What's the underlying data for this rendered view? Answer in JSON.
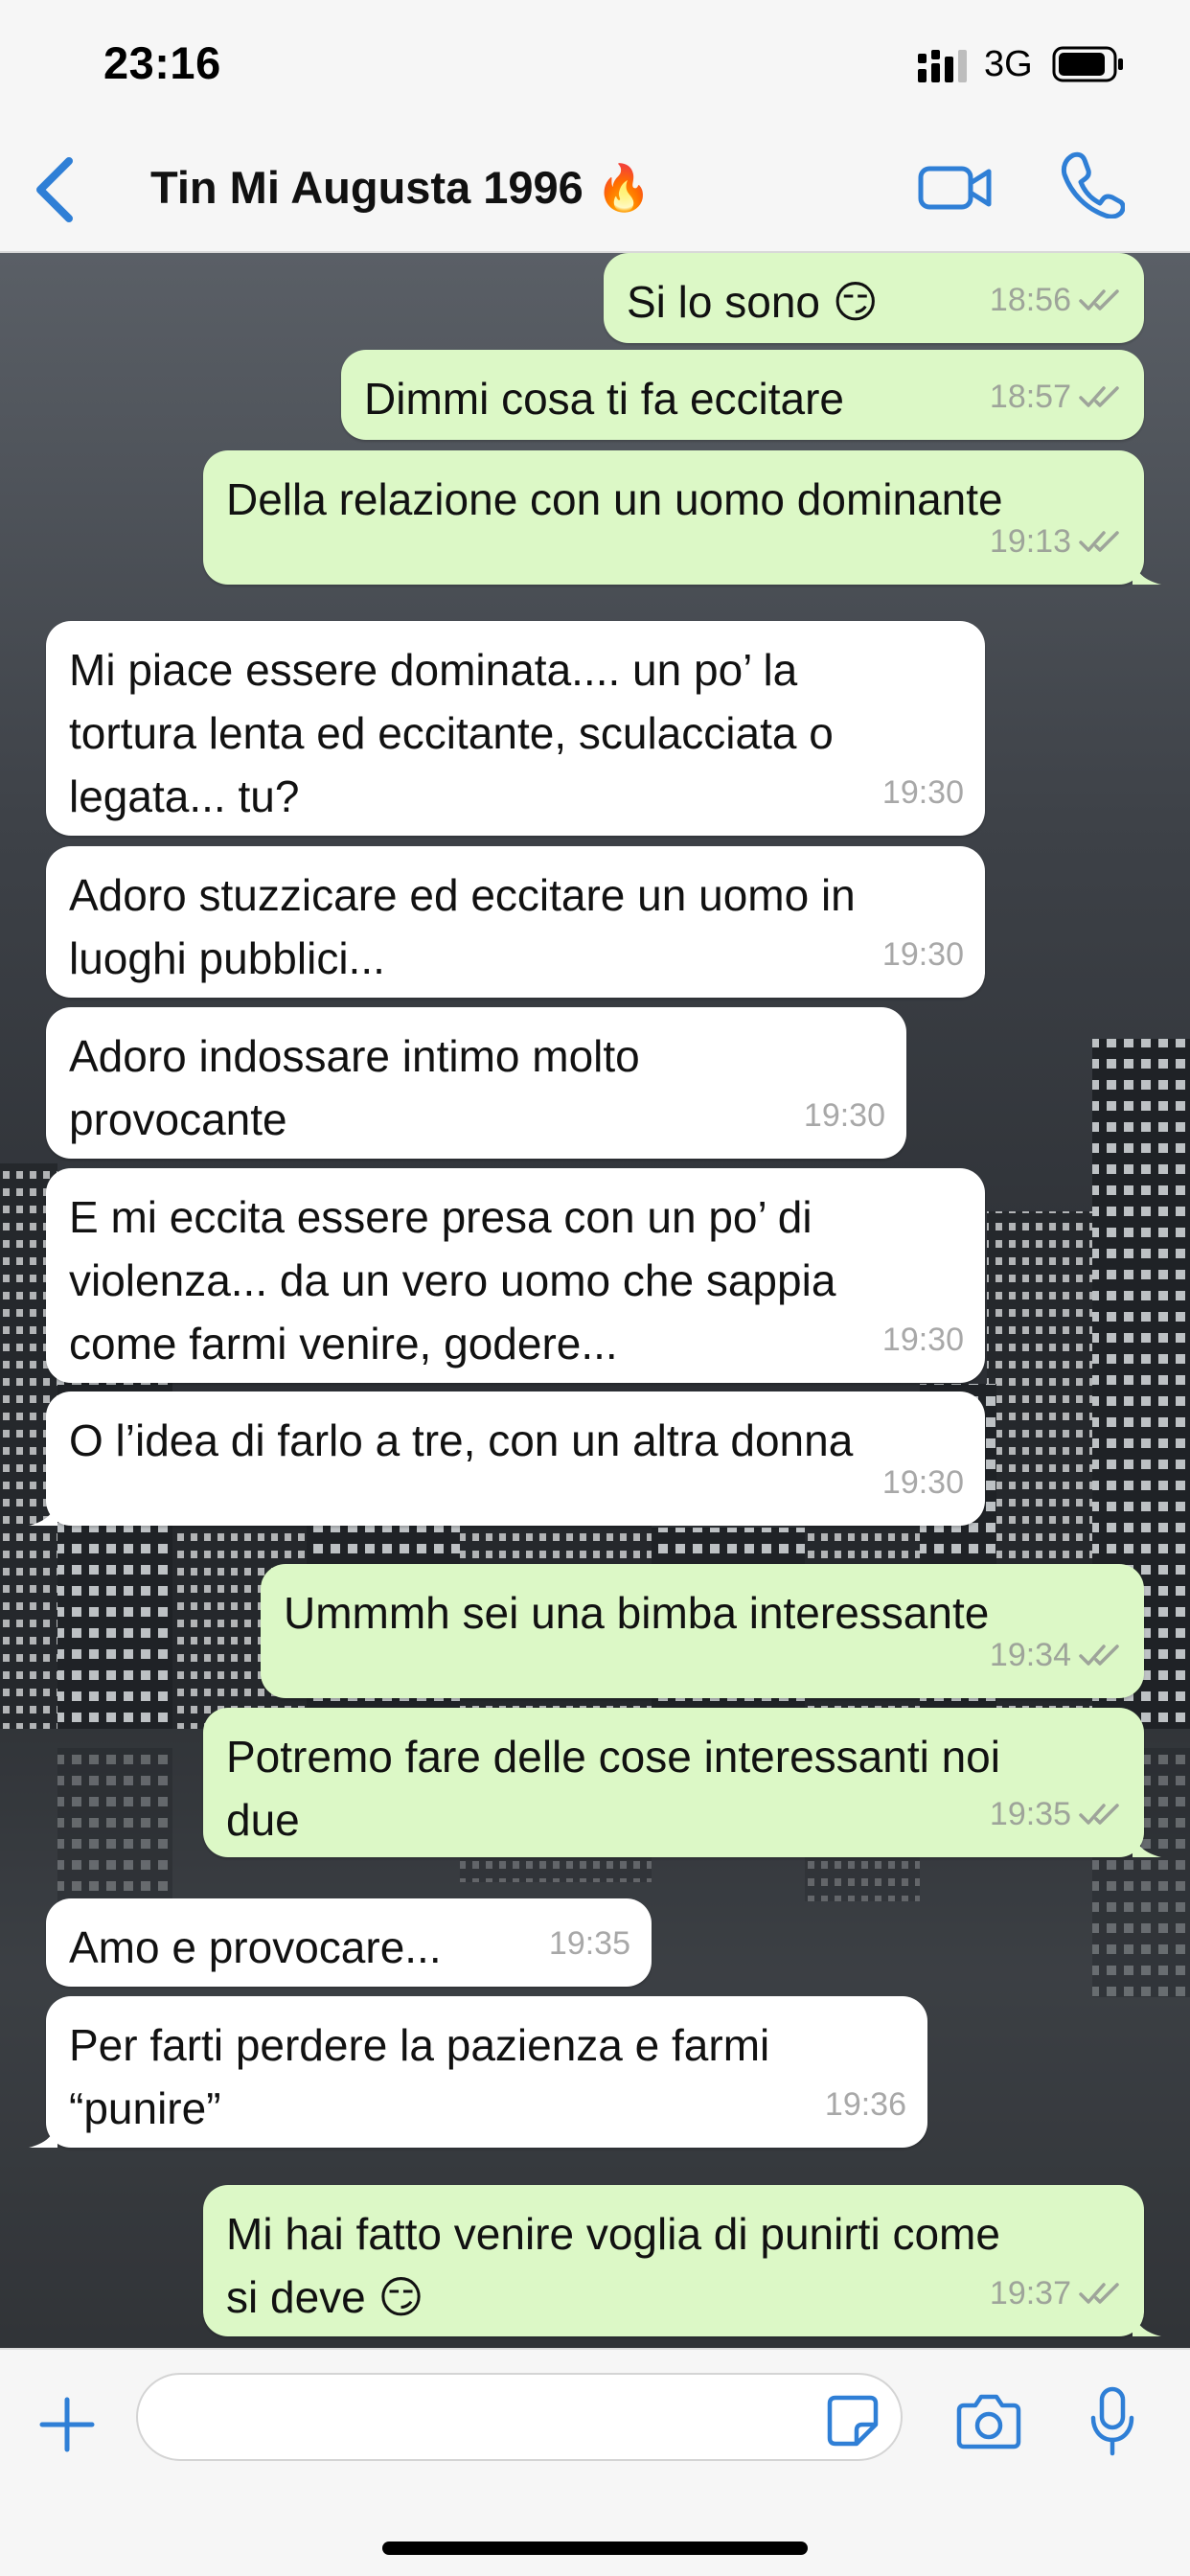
{
  "status_bar": {
    "time": "23:16",
    "network": "3G"
  },
  "header": {
    "contact_name": "Tin Mi Augusta 1996 🔥"
  },
  "messages": [
    {
      "dir": "out",
      "text": "Si lo sono 😏",
      "time": "18:56"
    },
    {
      "dir": "out",
      "text": "Dimmi cosa ti fa eccitare",
      "time": "18:57"
    },
    {
      "dir": "out",
      "text": "Della relazione con un uomo dominante",
      "time": "19:13"
    },
    {
      "dir": "in",
      "text": "Mi piace essere dominata.... un po’ la\ntortura lenta ed eccitante, sculacciata o\nlegata... tu?",
      "time": "19:30"
    },
    {
      "dir": "in",
      "text": "Adoro stuzzicare ed eccitare un uomo in\nluoghi pubblici...",
      "time": "19:30"
    },
    {
      "dir": "in",
      "text": "Adoro indossare intimo molto\nprovocante",
      "time": "19:30"
    },
    {
      "dir": "in",
      "text": "E mi eccita essere presa con un po’ di\nviolenza... da un vero uomo che sappia\ncome farmi venire, godere...",
      "time": "19:30"
    },
    {
      "dir": "in",
      "text": "O l’idea di farlo a tre, con un altra donna",
      "time": "19:30"
    },
    {
      "dir": "out",
      "text": "Ummmh sei una bimba interessante",
      "time": "19:34"
    },
    {
      "dir": "out",
      "text": "Potremo fare delle cose interessanti noi\ndue",
      "time": "19:35"
    },
    {
      "dir": "in",
      "text": "Amo e provocare...",
      "time": "19:35"
    },
    {
      "dir": "in",
      "text": "Per farti perdere la pazienza e farmi\n“punire”",
      "time": "19:36"
    },
    {
      "dir": "out",
      "text": "Mi hai fatto venire voglia di punirti come\nsi deve 😏",
      "time": "19:37"
    }
  ],
  "colors": {
    "accent": "#2f7fd6",
    "outgoing_bubble": "#dcf8c6",
    "incoming_bubble": "#ffffff"
  },
  "icons": {
    "back": "chevron-left-icon",
    "video": "video-camera-icon",
    "phone": "phone-icon",
    "plus": "plus-icon",
    "sticker": "sticker-icon",
    "camera": "camera-icon",
    "mic": "microphone-icon",
    "scroll_down": "chevron-down-circle-icon",
    "read_receipt": "double-check-icon"
  }
}
